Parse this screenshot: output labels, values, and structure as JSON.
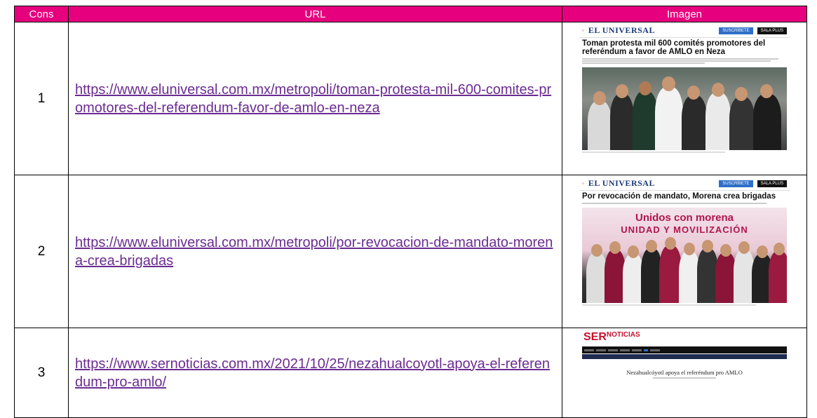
{
  "table": {
    "headers": [
      "Cons",
      "URL",
      "Imagen"
    ],
    "header_color": "#e6007e",
    "link_color": "#6b2c91",
    "rows": [
      {
        "cons": "1",
        "url": "https://www.eluniversal.com.mx/metropoli/toman-protesta-mil-600-comites-promotores-del-referendum-favor-de-amlo-en-neza",
        "thumb": {
          "logo": "EL UNIVERSAL",
          "headline": "Toman protesta mil 600 comités promotores del referéndum a favor de AMLO en Neza",
          "btn1": "SUSCRÍBETE",
          "btn2": "SALA PLUS"
        }
      },
      {
        "cons": "2",
        "url": "https://www.eluniversal.com.mx/metropoli/por-revocacion-de-mandato-morena-crea-brigadas",
        "thumb": {
          "logo": "EL UNIVERSAL",
          "headline": "Por revocación de mandato, Morena crea brigadas",
          "banner1": "Unidos con morena",
          "banner2": "UNIDAD Y MOVILIZACIÓN",
          "btn1": "SUSCRÍBETE",
          "btn2": "SALA PLUS"
        }
      },
      {
        "cons": "3",
        "url": "https://www.sernoticias.com.mx/2021/10/25/nezahualcoyotl-apoya-el-referendum-pro-amlo/",
        "thumb": {
          "logo_main": "SER",
          "logo_sup": "NOTICIAS",
          "headline": "Nezahualcóyotl apoya el referéndum pro AMLO"
        }
      }
    ]
  }
}
